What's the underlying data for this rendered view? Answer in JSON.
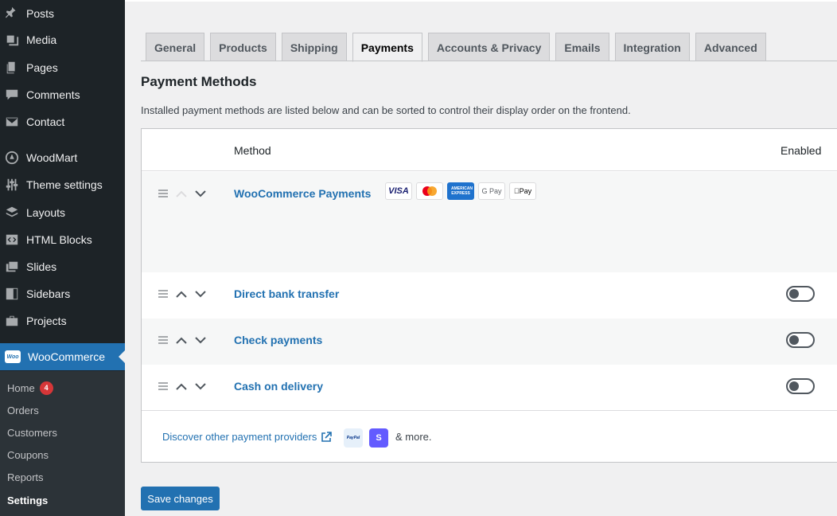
{
  "sidebar": {
    "items": [
      {
        "label": "Posts",
        "icon": "pin-icon"
      },
      {
        "label": "Media",
        "icon": "media-icon"
      },
      {
        "label": "Pages",
        "icon": "pages-icon"
      },
      {
        "label": "Comments",
        "icon": "comment-icon"
      },
      {
        "label": "Contact",
        "icon": "mail-icon"
      },
      {
        "label": "WoodMart",
        "icon": "woodmart-icon"
      },
      {
        "label": "Theme settings",
        "icon": "sliders-icon"
      },
      {
        "label": "Layouts",
        "icon": "layers-icon"
      },
      {
        "label": "HTML Blocks",
        "icon": "code-icon"
      },
      {
        "label": "Slides",
        "icon": "slides-icon"
      },
      {
        "label": "Sidebars",
        "icon": "sidebar-icon"
      },
      {
        "label": "Projects",
        "icon": "briefcase-icon"
      },
      {
        "label": "WooCommerce",
        "icon": "woocommerce-icon"
      }
    ],
    "woo_logo_text": "Woo",
    "submenu": {
      "home": "Home",
      "home_badge": "4",
      "orders": "Orders",
      "customers": "Customers",
      "coupons": "Coupons",
      "reports": "Reports",
      "settings": "Settings"
    }
  },
  "tabs": [
    "General",
    "Products",
    "Shipping",
    "Payments",
    "Accounts & Privacy",
    "Emails",
    "Integration",
    "Advanced"
  ],
  "active_tab": "Payments",
  "heading": "Payment Methods",
  "description": "Installed payment methods are listed below and can be sorted to control their display order on the frontend.",
  "table": {
    "col_method": "Method",
    "col_enabled": "Enabled",
    "rows": [
      {
        "name": "WooCommerce Payments",
        "enabled": null
      },
      {
        "name": "Direct bank transfer",
        "enabled": false
      },
      {
        "name": "Check payments",
        "enabled": false
      },
      {
        "name": "Cash on delivery",
        "enabled": false
      }
    ],
    "card_logos": {
      "visa": "VISA",
      "amex": "AMERICAN EXPRESS",
      "gpay": "G Pay",
      "applepay": "Pay"
    }
  },
  "discover": {
    "link": "Discover other payment providers",
    "paypal": "PayPal",
    "stripe": "S",
    "more": "& more."
  },
  "save_label": "Save changes",
  "colors": {
    "accent": "#2271b1",
    "sidebar": "#1d2327",
    "badge": "#d63638"
  }
}
